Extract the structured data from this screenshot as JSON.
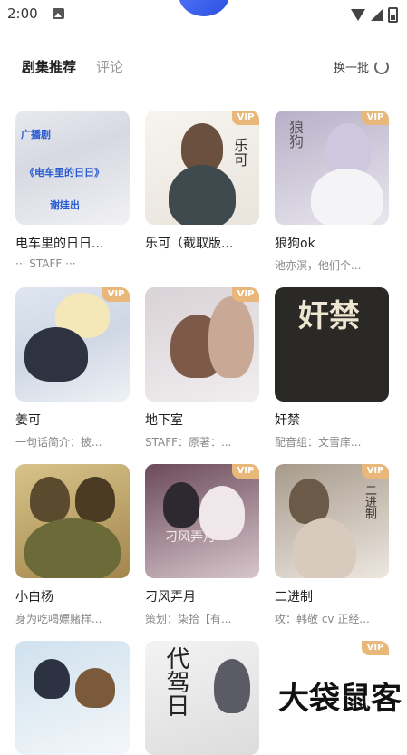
{
  "status_bar": {
    "time": "2:00"
  },
  "tabs": {
    "active": "剧集推荐",
    "inactive": "评论"
  },
  "refresh": {
    "label": "换一批"
  },
  "badge": "VIP",
  "cards": [
    {
      "title": "电车里的日日...",
      "sub": "··· STAFF ···",
      "vip": false,
      "cover_text": [
        "广播剧",
        "《电车里的日日》",
        "谢娃出"
      ]
    },
    {
      "title": "乐可（截取版...",
      "sub": "",
      "vip": true,
      "cover_text": [
        "乐可"
      ]
    },
    {
      "title": "狼狗ok",
      "sub": "池亦溟，他们个...",
      "vip": true,
      "cover_text": [
        "狼狗"
      ]
    },
    {
      "title": "姜可",
      "sub": "一句话简介：披...",
      "vip": true,
      "cover_text": []
    },
    {
      "title": "地下室",
      "sub": "STAFF：原著：...",
      "vip": true,
      "cover_text": []
    },
    {
      "title": "奸禁",
      "sub": "配音组：文雪庠...",
      "vip": false,
      "cover_text": [
        "奸禁"
      ]
    },
    {
      "title": "小白杨",
      "sub": "身为吃喝嫖赌样...",
      "vip": false,
      "cover_text": []
    },
    {
      "title": "刁风弄月",
      "sub": "策划：柒拾【有...",
      "vip": true,
      "cover_text": [
        "刁风弄月"
      ]
    },
    {
      "title": "二进制",
      "sub": "攻：韩敬 cv 正经...",
      "vip": true,
      "cover_text": [
        "二进制"
      ]
    },
    {
      "title": "",
      "sub": "",
      "vip": false,
      "cover_text": []
    },
    {
      "title": "",
      "sub": "",
      "vip": false,
      "cover_text": [
        "代驾日"
      ]
    },
    {
      "title": "",
      "sub": "",
      "vip": true,
      "cover_text": []
    }
  ],
  "watermark": {
    "text": "大袋鼠客"
  }
}
